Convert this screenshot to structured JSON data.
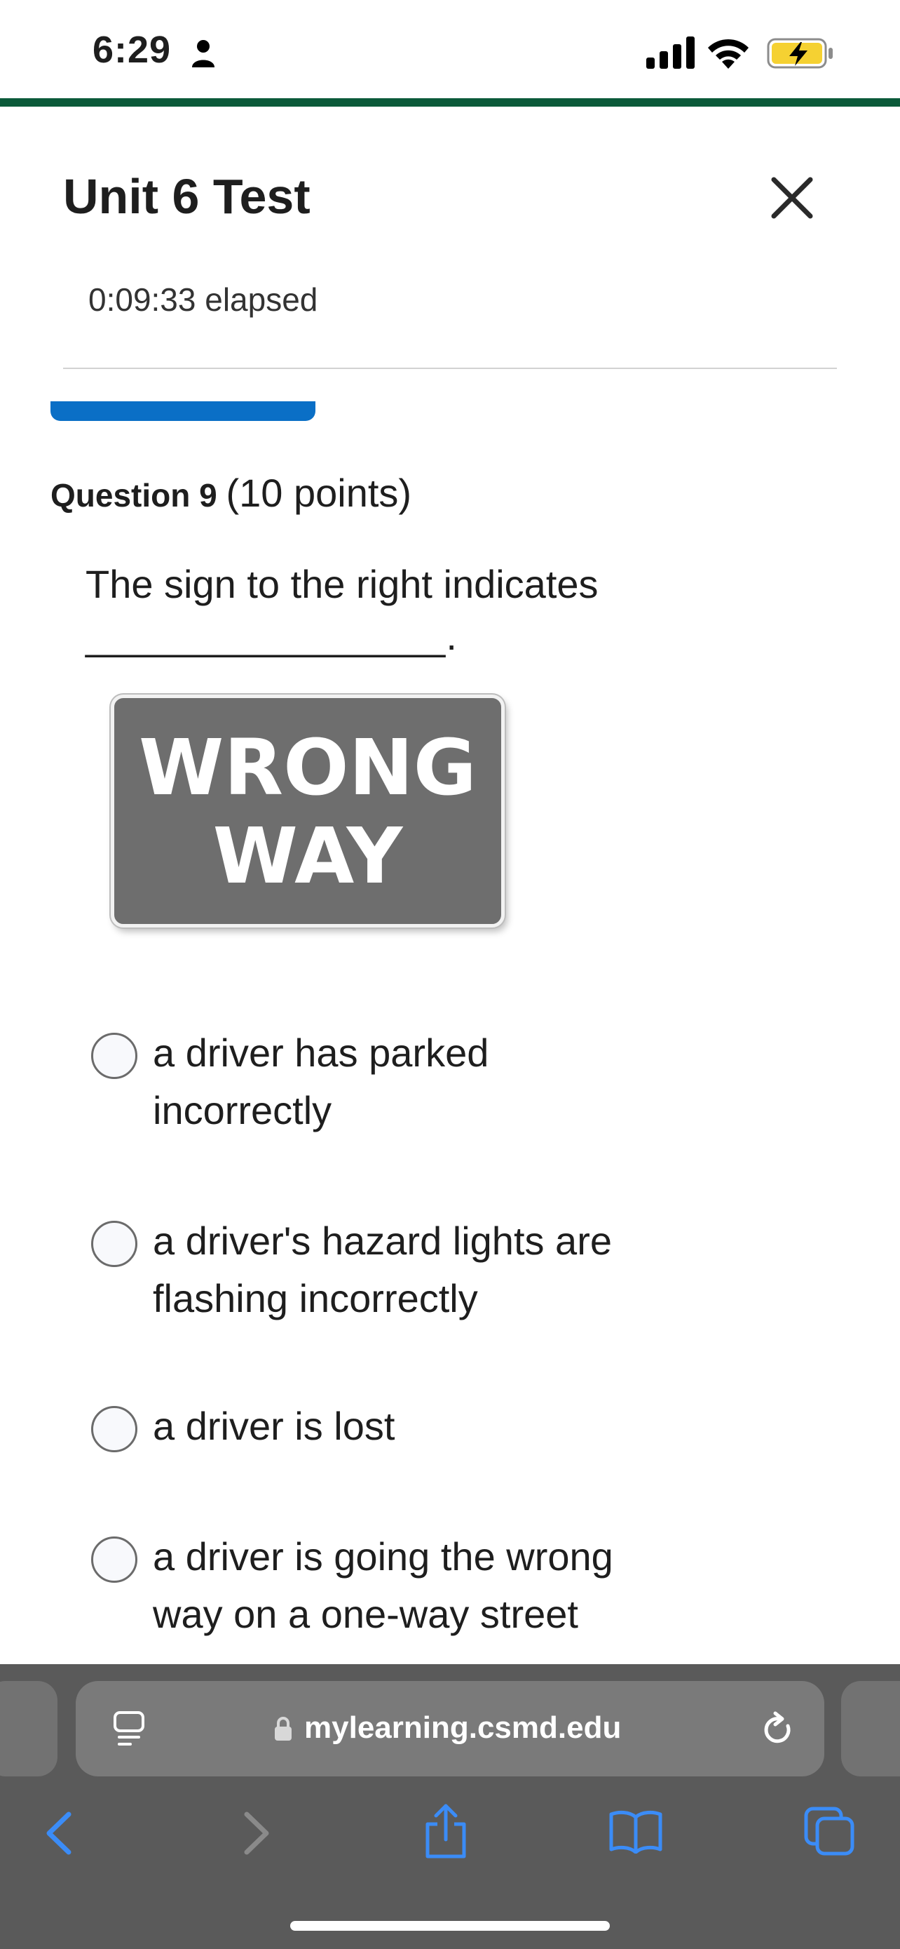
{
  "status_bar": {
    "time": "6:29",
    "icons": [
      "person-icon",
      "signal-icon",
      "wifi-icon",
      "battery-charging-icon"
    ]
  },
  "colors": {
    "accent_green": "#0b5a3a",
    "progress_blue": "#0a6fc6",
    "browser_blue": "#3b8cf7",
    "battery_yellow": "#f5d132"
  },
  "header": {
    "title": "Unit 6 Test",
    "close_icon": "close-icon",
    "elapsed": "0:09:33 elapsed"
  },
  "question": {
    "number_label": "Question 9",
    "points": "(10 points)",
    "prompt": "The sign to the right indicates",
    "blank": "________________.",
    "sign": {
      "line1": "WRONG",
      "line2": "WAY"
    },
    "options": [
      {
        "line1": "a driver has parked",
        "line2": "incorrectly",
        "selected": false
      },
      {
        "line1": "a driver's hazard lights are",
        "line2": "flashing incorrectly",
        "selected": false
      },
      {
        "line1": "a driver is lost",
        "line2": "",
        "selected": false
      },
      {
        "line1": "a driver is going the wrong",
        "line2": "way on a one-way street",
        "selected": false
      }
    ]
  },
  "browser": {
    "url": "mylearning.csmd.edu",
    "toolbar_icons": [
      "back-icon",
      "forward-icon",
      "share-icon",
      "bookmarks-icon",
      "tabs-icon"
    ]
  }
}
